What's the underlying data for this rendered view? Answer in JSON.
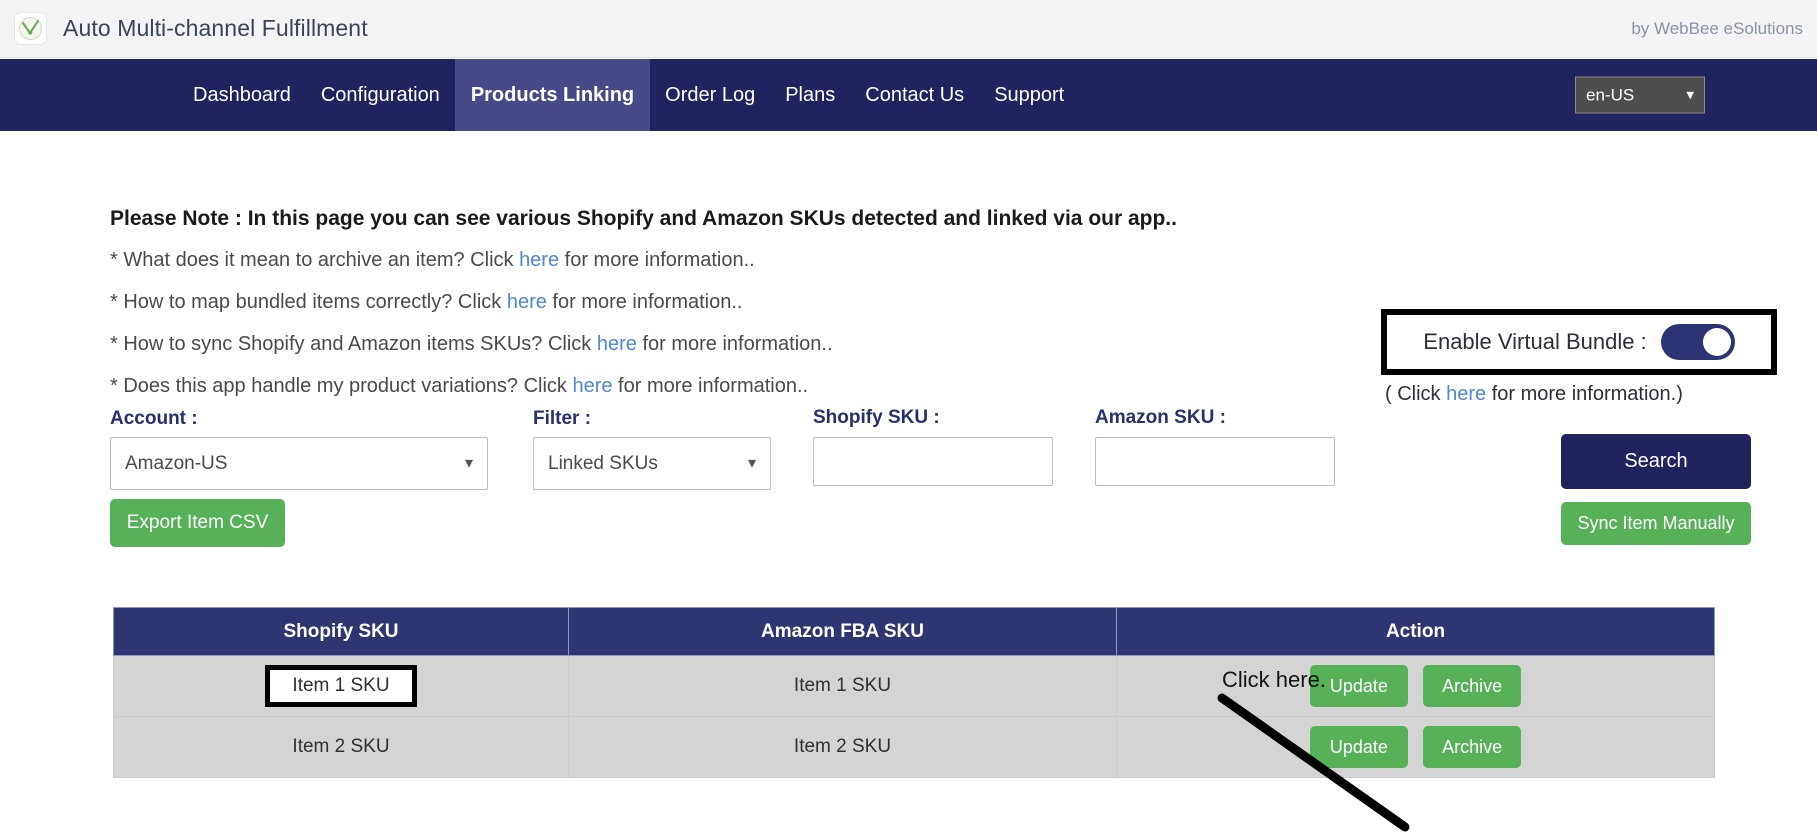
{
  "topbar": {
    "logo_icon": "app-logo-icon",
    "title": "Auto Multi-channel Fulfillment",
    "by_line": "by WebBee eSolutions"
  },
  "nav": {
    "items": [
      {
        "label": "Dashboard",
        "active": false
      },
      {
        "label": "Configuration",
        "active": false
      },
      {
        "label": "Products Linking",
        "active": true
      },
      {
        "label": "Order Log",
        "active": false
      },
      {
        "label": "Plans",
        "active": false
      },
      {
        "label": "Contact Us",
        "active": false
      },
      {
        "label": "Support",
        "active": false
      }
    ],
    "language": {
      "value": "en-US",
      "caret_icon": "chevron-down-icon"
    }
  },
  "notes": {
    "title": "Please Note : In this page you can see various Shopify and Amazon SKUs detected and linked via our app..",
    "line1_pre": "* What does it mean to archive an item? Click ",
    "line1_link": "here",
    "line1_post": " for more information..",
    "line2_pre": "* How to map bundled items correctly? Click ",
    "line2_link": "here",
    "line2_post": " for more information..",
    "line3_pre": "* How to sync Shopify and Amazon items SKUs? Click ",
    "line3_link": "here",
    "line3_post": " for more information..",
    "line4_pre": "* Does this app handle my product variations? Click ",
    "line4_link": "here",
    "line4_post": " for more information.."
  },
  "virtual_bundle": {
    "label": "Enable Virtual Bundle :",
    "toggle_state": "on",
    "sub_pre": "( Click ",
    "sub_link": "here",
    "sub_post": " for more information.)"
  },
  "filters": {
    "account_label": "Account :",
    "account_value": "Amazon-US",
    "filter_label": "Filter :",
    "filter_value": "Linked SKUs",
    "shopify_sku_label": "Shopify SKU :",
    "shopify_sku_value": "",
    "shopify_sku_placeholder": "",
    "amazon_sku_label": "Amazon SKU :",
    "amazon_sku_value": "",
    "amazon_sku_placeholder": "",
    "caret_icon": "chevron-down-icon"
  },
  "actions": {
    "search_label": "Search",
    "sync_label": "Sync Item Manually",
    "export_label": "Export Item CSV"
  },
  "annotation": {
    "click_here_text": "Click here.",
    "arrow_icon": "arrow-pointer-line"
  },
  "table": {
    "headers": [
      "Shopify SKU",
      "Amazon FBA SKU",
      "Action"
    ],
    "rows": [
      {
        "shopify_sku": "Item 1 SKU",
        "amazon_sku": "Item 1 SKU",
        "update_label": "Update",
        "archive_label": "Archive",
        "highlighted": true
      },
      {
        "shopify_sku": "Item 2 SKU",
        "amazon_sku": "Item 2 SKU",
        "update_label": "Update",
        "archive_label": "Archive",
        "highlighted": false
      }
    ]
  },
  "colors": {
    "nav_navy": "#20235e",
    "nav_active": "#474a87",
    "table_header": "#2f3570",
    "row_grey": "#d4d4d4",
    "green": "#56b158",
    "link_blue": "#4f87d4",
    "label_navy": "#26306d"
  }
}
